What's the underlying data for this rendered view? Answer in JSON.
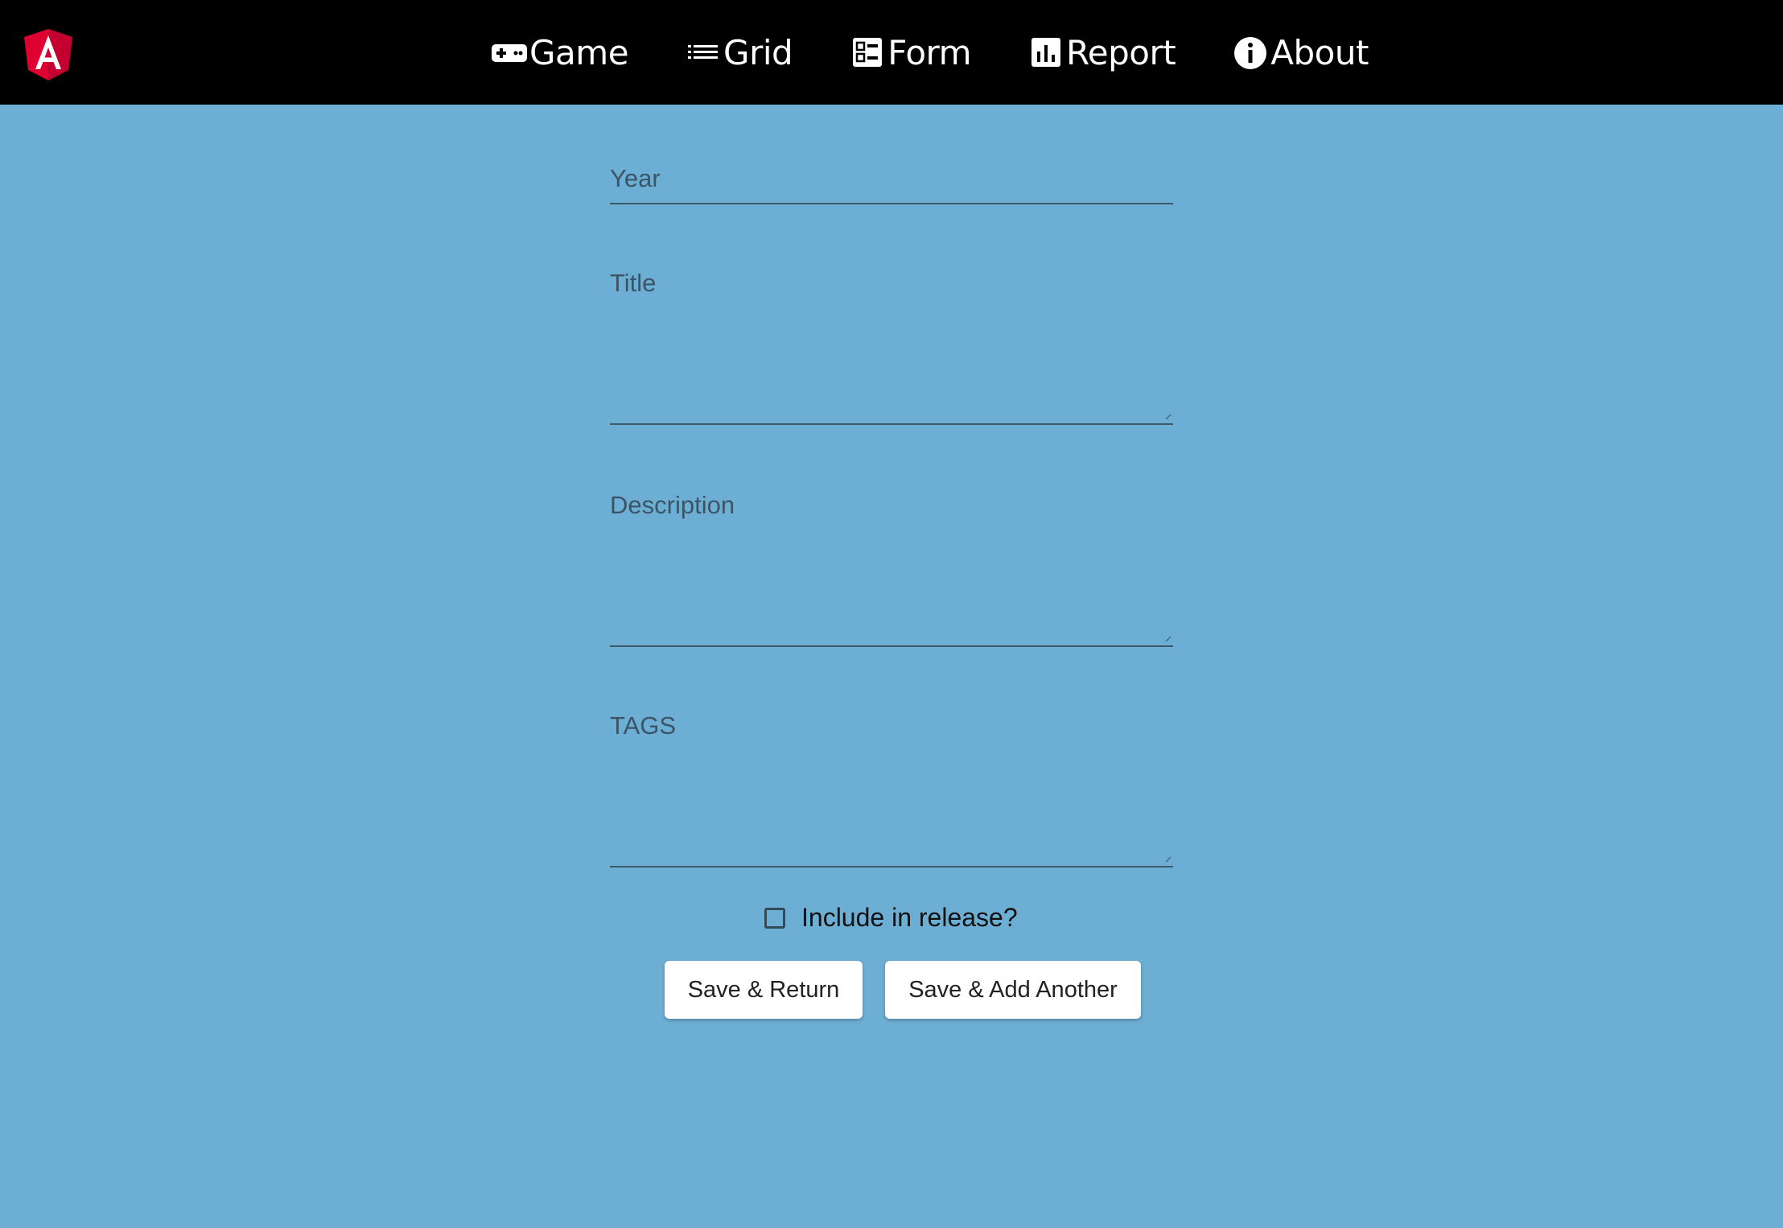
{
  "nav": {
    "items": [
      {
        "label": "Game",
        "icon": "gamepad-icon"
      },
      {
        "label": "Grid",
        "icon": "list-icon"
      },
      {
        "label": "Form",
        "icon": "form-icon"
      },
      {
        "label": "Report",
        "icon": "bar-chart-icon"
      },
      {
        "label": "About",
        "icon": "info-icon"
      }
    ]
  },
  "colors": {
    "topbar": "#000000",
    "background": "#6daed4",
    "logo": "#dd0031"
  },
  "form": {
    "year_label": "Year",
    "title_label": "Title",
    "description_label": "Description",
    "tags_label": "TAGS",
    "release_label": "Include in release?",
    "release_checked": false
  },
  "buttons": {
    "save_return": "Save & Return",
    "save_add": "Save & Add Another"
  }
}
